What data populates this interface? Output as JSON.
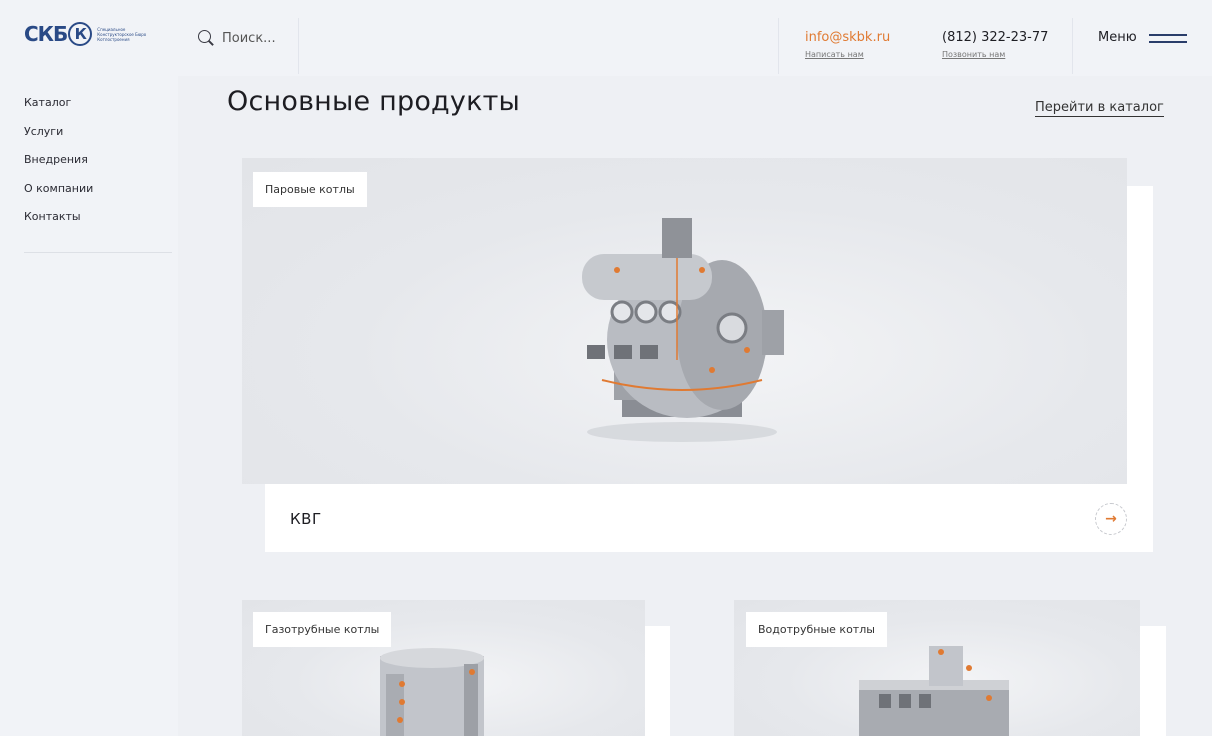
{
  "header": {
    "logo_mark": "СКБ",
    "logo_letter": "К",
    "logo_text": "Специальное Конструкторское Бюро Котлостроения",
    "search_placeholder": "Поиск...",
    "email": "info@skbk.ru",
    "email_sub": "Написать нам",
    "phone": "(812) 322-23-77",
    "phone_sub": "Позвонить нам",
    "menu_label": "Меню"
  },
  "sidebar": {
    "items": [
      {
        "label": "Каталог"
      },
      {
        "label": "Услуги"
      },
      {
        "label": "Внедрения"
      },
      {
        "label": "О компании"
      },
      {
        "label": "Контакты"
      }
    ]
  },
  "main": {
    "title": "Основные продукты",
    "catalog_link": "Перейти в каталог",
    "featured": {
      "tag": "Паровые котлы",
      "name": "КВГ"
    },
    "cards": [
      {
        "tag": "Газотрубные котлы"
      },
      {
        "tag": "Водотрубные котлы"
      }
    ]
  },
  "colors": {
    "accent": "#e07a32",
    "brand": "#2a4a86",
    "background": "#f1f3f7"
  },
  "icons": {
    "search": "search-icon",
    "menu": "burger-menu-icon",
    "arrow": "arrow-right-icon"
  }
}
